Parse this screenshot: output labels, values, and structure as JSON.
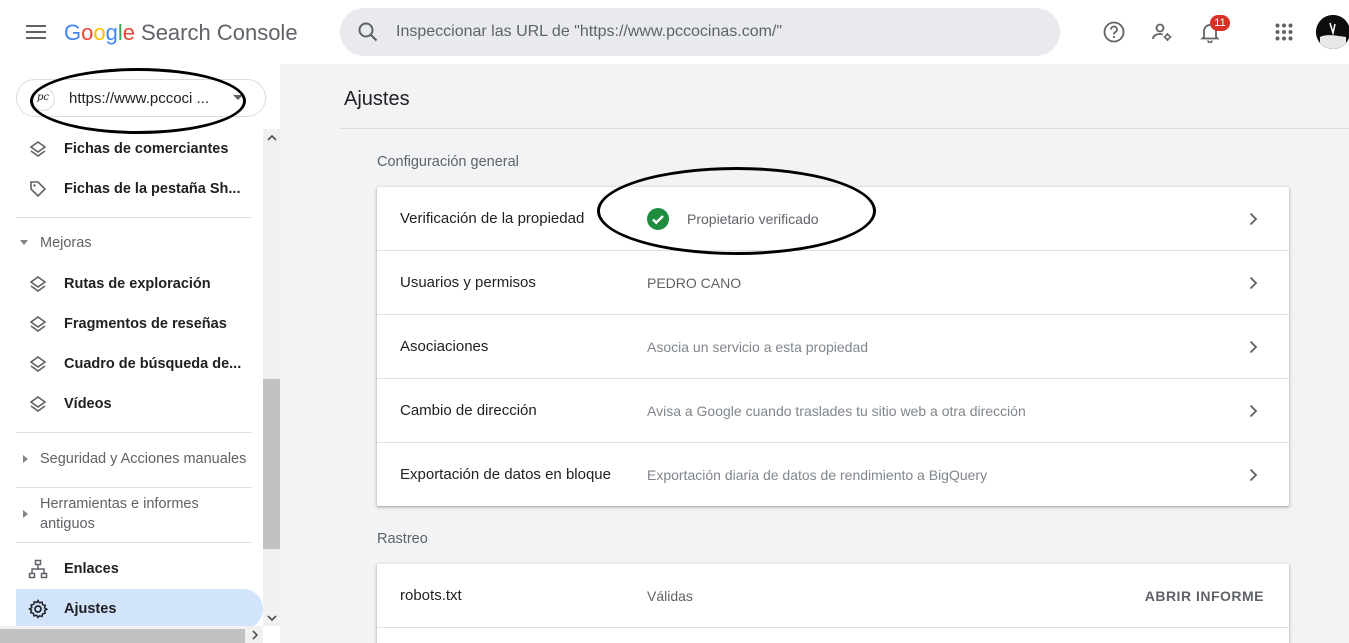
{
  "header": {
    "menu_icon": "hamburger-menu-icon",
    "logo": {
      "g1": "G",
      "g2": "o",
      "g3": "o",
      "g4": "g",
      "g5": "l",
      "g6": "e",
      "product": "Search Console"
    },
    "search_placeholder": "Inspeccionar las URL de \"https://www.pccocinas.com/\"",
    "search_icon": "search-icon",
    "help_icon": "help-icon",
    "users_icon": "manage-users-icon",
    "notifications_icon": "bell-icon",
    "notifications_count": "11",
    "apps_icon": "apps-grid-icon"
  },
  "sidebar": {
    "property": {
      "logo_text": "pc",
      "url": "https://www.pccoci ..."
    },
    "items": [
      {
        "label": "Fichas de comerciantes",
        "icon": "layers-icon"
      },
      {
        "label": "Fichas de la pestaña Sh...",
        "icon": "tag-icon"
      }
    ],
    "section_mejoras": "Mejoras",
    "mejoras_items": [
      {
        "label": "Rutas de exploración",
        "icon": "layers-icon"
      },
      {
        "label": "Fragmentos de reseñas",
        "icon": "layers-icon"
      },
      {
        "label": "Cuadro de búsqueda de...",
        "icon": "layers-icon"
      },
      {
        "label": "Vídeos",
        "icon": "layers-icon"
      }
    ],
    "section_security": "Seguridad y Acciones manuales",
    "section_tools": "Herramientas e informes antiguos",
    "links": {
      "label": "Enlaces",
      "icon": "sitemap-icon"
    },
    "settings": {
      "label": "Ajustes",
      "icon": "gear-icon"
    }
  },
  "main": {
    "title": "Ajustes",
    "general_label": "Configuración general",
    "general_rows": [
      {
        "label": "Verificación de la propiedad",
        "value": "Propietario verificado",
        "status_icon": "check-circle-icon"
      },
      {
        "label": "Usuarios y permisos",
        "value": "PEDRO CANO"
      },
      {
        "label": "Asociaciones",
        "value": "Asocia un servicio a esta propiedad"
      },
      {
        "label": "Cambio de dirección",
        "value": "Avisa a Google cuando traslades tu sitio web a otra dirección"
      },
      {
        "label": "Exportación de datos en bloque",
        "value": "Exportación diaria de datos de rendimiento a BigQuery"
      }
    ],
    "crawl_label": "Rastreo",
    "crawl_rows": [
      {
        "label": "robots.txt",
        "value": "Válidas",
        "action": "ABRIR INFORME"
      }
    ]
  },
  "colors": {
    "accent": "#1a73e8",
    "active_nav": "#d2e3fc",
    "verified": "#1e8e3e",
    "badge": "#d93025"
  }
}
